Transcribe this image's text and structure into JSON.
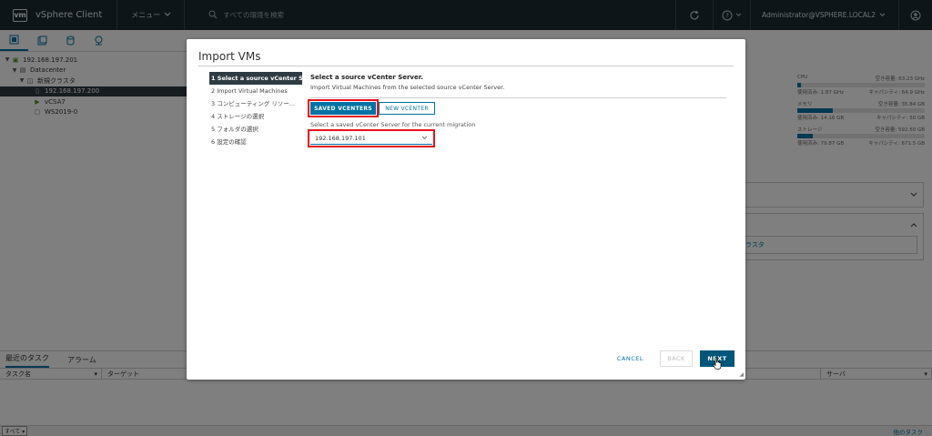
{
  "header": {
    "logo": "vm",
    "app_title": "vSphere Client",
    "menu_label": "メニュー",
    "search_placeholder": "すべての環境を検索",
    "help_label": "?",
    "user": "Administrator@VSPHERE.LOCAL2"
  },
  "navigator": {
    "tree": [
      {
        "label": "192.168.197.201",
        "level": 0,
        "icon": "vcenter-icon"
      },
      {
        "label": "Datacenter",
        "level": 1,
        "icon": "datacenter-icon"
      },
      {
        "label": "新規クラスタ",
        "level": 2,
        "icon": "cluster-icon"
      },
      {
        "label": "192.168.197.200",
        "level": 3,
        "icon": "host-icon",
        "selected": true
      },
      {
        "label": "vCSA7",
        "level": 3,
        "icon": "vm-icon"
      },
      {
        "label": "WS2019-0",
        "level": 3,
        "icon": "vm-icon"
      }
    ]
  },
  "background": {
    "resources": [
      {
        "name": "CPU",
        "free": "空き容量: 63.23 GHz",
        "used": "使用済み: 1.87 GHz",
        "capacity": "キャパシティ: 64.9 GHz",
        "fill": 0.03
      },
      {
        "name": "メモリ",
        "free": "空き容量: 35.84 GB",
        "used": "使用済み: 14.16 GB",
        "capacity": "キャパシティ: 50 GB",
        "fill": 0.28
      },
      {
        "name": "ストレージ",
        "free": "空き容量: 592.50 GB",
        "used": "使用済み: 79.87 GB",
        "capacity": "キャパシティ: 671.5 GB",
        "fill": 0.12
      }
    ],
    "cluster_text": "ラスタ"
  },
  "bottom": {
    "tabs": [
      "最近のタスク",
      "アラーム"
    ],
    "columns": [
      "タスク名",
      "ターゲット",
      "サーバ"
    ],
    "filter": "すべて",
    "more_tasks": "他のタスク"
  },
  "modal": {
    "title": "Import VMs",
    "steps": [
      "1 Select a source vCenter S...",
      "2 Import Virtual Machines",
      "3 コンピューティング リソー...",
      "4 ストレージの選択",
      "5 フォルダの選択",
      "6 設定の確認"
    ],
    "heading": "Select a source vCenter Server.",
    "description": "Import Virtual Machines from the selected source vCenter Server.",
    "saved_button": "SAVED VCENTERS",
    "new_button": "NEW VCENTER",
    "saved_label": "Select a saved vCenter Server for the current migration",
    "selected_vcenter": "192.168.197.101",
    "cancel": "CANCEL",
    "back": "BACK",
    "next": "NEXT"
  }
}
